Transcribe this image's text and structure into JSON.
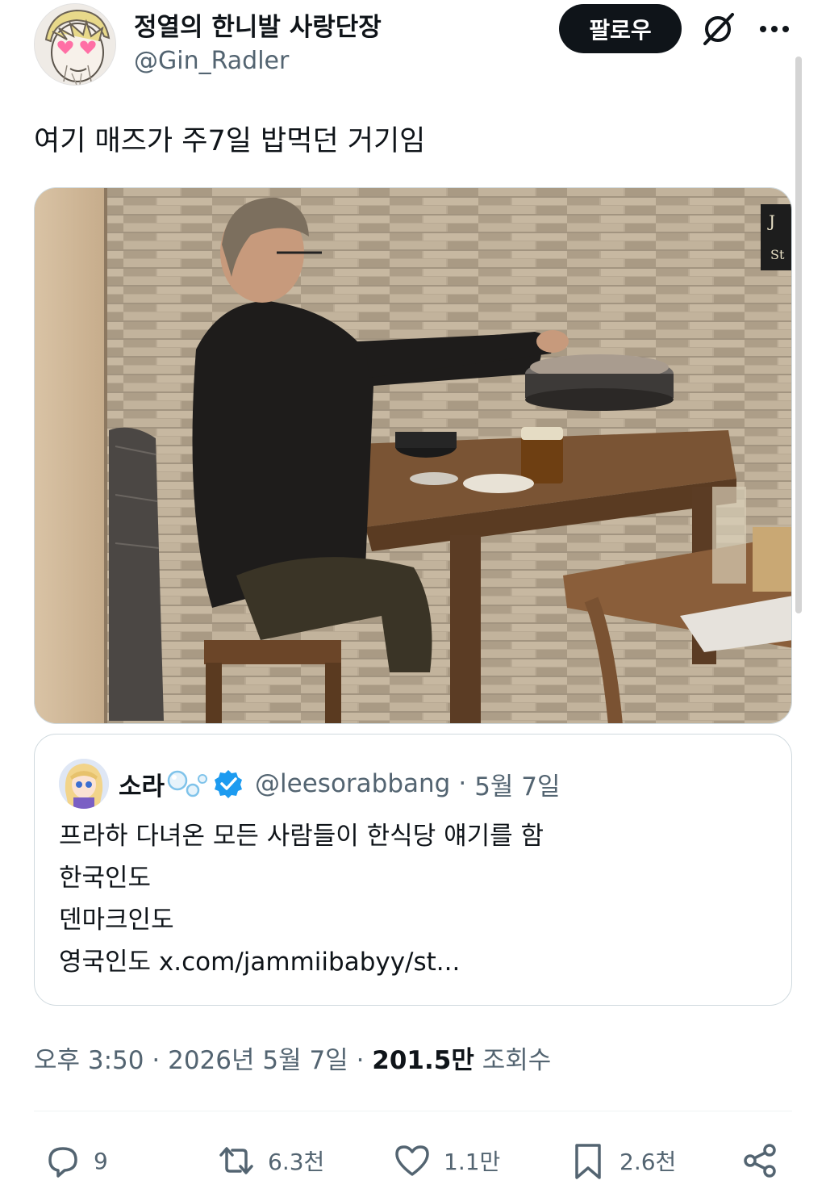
{
  "author": {
    "display_name": "정열의 한니발 사랑단장",
    "handle": "@Gin_Radler",
    "avatar_icon": "anime-avatar-heart-eyes"
  },
  "header": {
    "follow_label": "팔로우",
    "grok_icon": "grok-icon",
    "more_icon": "more-icon"
  },
  "tweet": {
    "text": "여기 매즈가 주7일 밥먹던 거기임",
    "photo": "photo-man-at-korean-bbq-table"
  },
  "quote": {
    "name": "소라",
    "handle": "@leesorabbang",
    "date": "5월 7일",
    "lines": [
      "프라하 다녀온 모든 사람들이 한식당 얘기를 함",
      "한국인도",
      "덴마크인도",
      "영국인도 x.com/jammiibabyy/st..."
    ],
    "verified_color": "#1d9bf0"
  },
  "meta": {
    "time": "오후 3:50",
    "date": "2026년 5월 7일",
    "views_count": "201.5만",
    "views_label": "조회수"
  },
  "actions": {
    "reply_count": "9",
    "retweet_count": "6.3천",
    "like_count": "1.1만",
    "bookmark_count": "2.6천"
  },
  "colors": {
    "text": "#0f1419",
    "secondary": "#536471",
    "border": "#cfd9de",
    "follow_bg": "#0f1419"
  }
}
